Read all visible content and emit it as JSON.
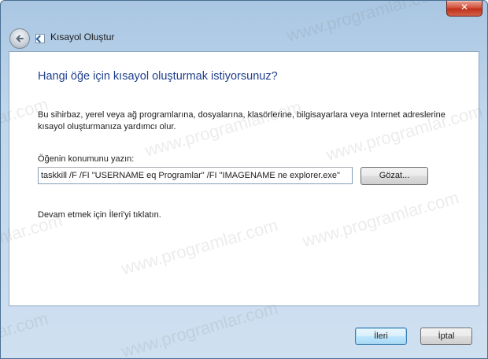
{
  "window": {
    "title": "Kısayol Oluştur",
    "close_label": "✕"
  },
  "content": {
    "heading": "Hangi öğe için kısayol oluşturmak istiyorsunuz?",
    "description": "Bu sihirbaz, yerel veya ağ programlarına, dosyalarına, klasörlerine, bilgisayarlara veya Internet adreslerine kısayol oluşturmanıza yardımcı olur.",
    "location_label": "Öğenin konumunu yazın:",
    "location_value": "taskkill /F /FI \"USERNAME eq Programlar\" /FI \"IMAGENAME ne explorer.exe\"",
    "browse_label": "Gözat...",
    "continue_text": "Devam etmek için İleri'yi tıklatın."
  },
  "footer": {
    "next_label": "İleri",
    "cancel_label": "İptal"
  },
  "watermark": {
    "site": "www.programlar.com",
    "short": "lar.com",
    "fragment": "mlar.com"
  },
  "colors": {
    "heading": "#1e3f8c",
    "frame": "#bfd6ec",
    "close": "#c0301a"
  }
}
